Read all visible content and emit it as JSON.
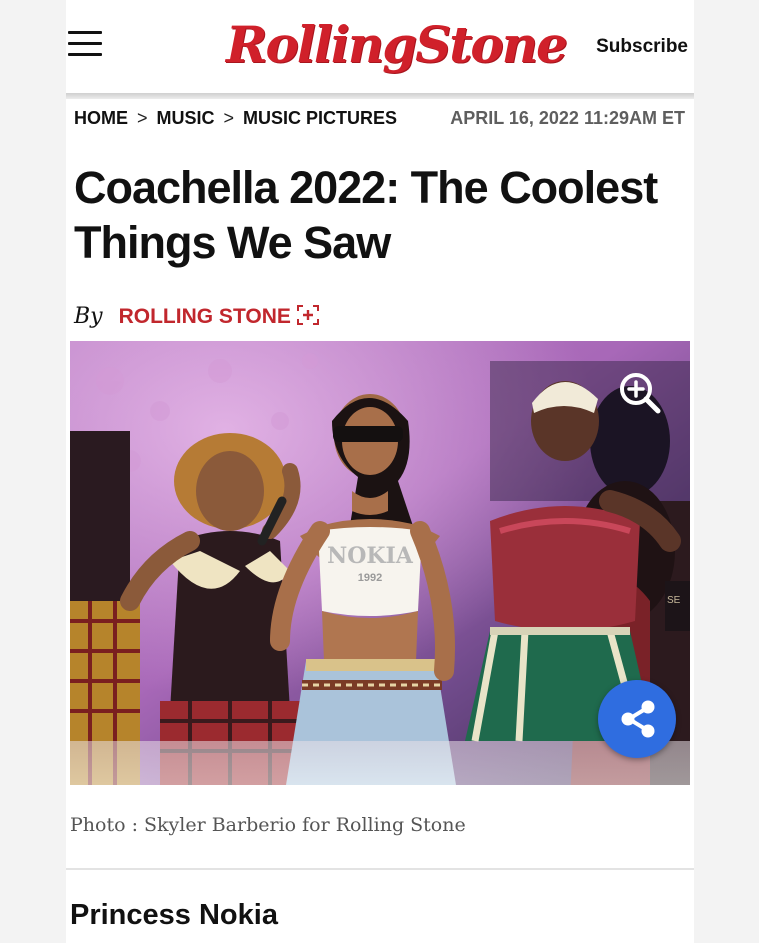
{
  "header": {
    "logo": "RollingStone",
    "subscribe_label": "Subscribe"
  },
  "breadcrumb": {
    "items": [
      "HOME",
      "MUSIC",
      "MUSIC PICTURES"
    ],
    "separator": ">"
  },
  "timestamp": "APRIL 16, 2022 11:29AM ET",
  "headline": "Coachella 2022: The Coolest Things We Saw",
  "byline": {
    "prefix": "By",
    "author": "ROLLING STONE"
  },
  "hero": {
    "shirt_text": "NOKIA",
    "shirt_year": "1992",
    "sign_text": "SE"
  },
  "caption": "Photo : Skyler Barberio for Rolling Stone",
  "section_title": "Princess Nokia",
  "icons": {
    "menu": "hamburger-menu-icon",
    "author_expand": "plus-square-icon",
    "zoom": "zoom-in-icon",
    "share": "share-icon"
  },
  "colors": {
    "brand_red": "#d0202a",
    "author_red": "#c1272d",
    "share_blue": "#2f6de0"
  }
}
